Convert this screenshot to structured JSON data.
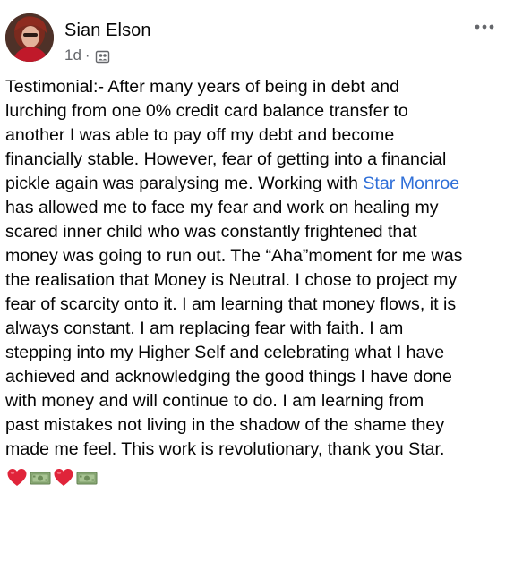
{
  "post": {
    "author_name": "Sian Elson",
    "timestamp": "1d",
    "separator": "·",
    "audience_icon": "group-audience-icon",
    "more_icon": "more-dots-icon",
    "text_before_mention": "Testimonial:- After many years of being in debt and\nlurching from one 0% credit card balance transfer to\nanother I was able to pay off my debt and become\nfinancially stable. However, fear of getting into a financial\npickle again was paralysing me. Working with ",
    "mention": "Star Monroe",
    "text_after_mention": "\nhas allowed me to face my fear and work on healing my\nscared inner child who was constantly frightened that\nmoney was going to run out. The “Aha”moment for me was\nthe realisation that Money is Neutral. I chose to project my\nfear of scarcity onto it. I am learning that money flows, it is\nalways constant. I am replacing fear with faith. I am\nstepping into my Higher Self and celebrating what I have\nachieved and acknowledging the good things I have done\nwith money and will continue to do.  I am learning from\npast mistakes not living in the shadow of the shame they\nmade me feel. This work is revolutionary, thank you Star.",
    "emojis": [
      "red-heart-emoji",
      "money-bill-emoji",
      "red-heart-emoji",
      "money-bill-emoji"
    ]
  },
  "colors": {
    "mention_blue": "#2f6fd8",
    "meta_gray": "#65676b",
    "text_black": "#050505",
    "heart_red": "#e0243a",
    "bill_green": "#8fae7a"
  }
}
